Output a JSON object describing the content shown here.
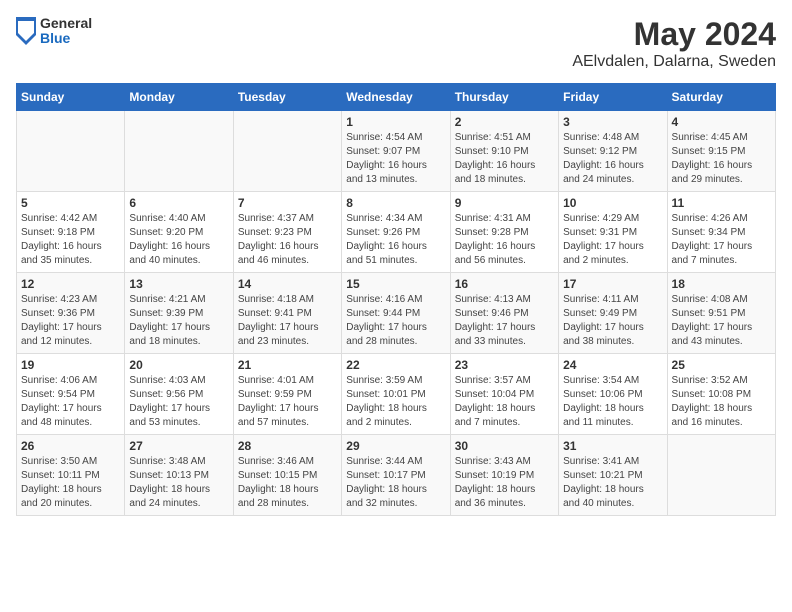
{
  "header": {
    "logo_general": "General",
    "logo_blue": "Blue",
    "title": "May 2024",
    "subtitle": "AElvdalen, Dalarna, Sweden"
  },
  "weekdays": [
    "Sunday",
    "Monday",
    "Tuesday",
    "Wednesday",
    "Thursday",
    "Friday",
    "Saturday"
  ],
  "rows": [
    [
      {
        "day": "",
        "content": ""
      },
      {
        "day": "",
        "content": ""
      },
      {
        "day": "",
        "content": ""
      },
      {
        "day": "1",
        "content": "Sunrise: 4:54 AM\nSunset: 9:07 PM\nDaylight: 16 hours\nand 13 minutes."
      },
      {
        "day": "2",
        "content": "Sunrise: 4:51 AM\nSunset: 9:10 PM\nDaylight: 16 hours\nand 18 minutes."
      },
      {
        "day": "3",
        "content": "Sunrise: 4:48 AM\nSunset: 9:12 PM\nDaylight: 16 hours\nand 24 minutes."
      },
      {
        "day": "4",
        "content": "Sunrise: 4:45 AM\nSunset: 9:15 PM\nDaylight: 16 hours\nand 29 minutes."
      }
    ],
    [
      {
        "day": "5",
        "content": "Sunrise: 4:42 AM\nSunset: 9:18 PM\nDaylight: 16 hours\nand 35 minutes."
      },
      {
        "day": "6",
        "content": "Sunrise: 4:40 AM\nSunset: 9:20 PM\nDaylight: 16 hours\nand 40 minutes."
      },
      {
        "day": "7",
        "content": "Sunrise: 4:37 AM\nSunset: 9:23 PM\nDaylight: 16 hours\nand 46 minutes."
      },
      {
        "day": "8",
        "content": "Sunrise: 4:34 AM\nSunset: 9:26 PM\nDaylight: 16 hours\nand 51 minutes."
      },
      {
        "day": "9",
        "content": "Sunrise: 4:31 AM\nSunset: 9:28 PM\nDaylight: 16 hours\nand 56 minutes."
      },
      {
        "day": "10",
        "content": "Sunrise: 4:29 AM\nSunset: 9:31 PM\nDaylight: 17 hours\nand 2 minutes."
      },
      {
        "day": "11",
        "content": "Sunrise: 4:26 AM\nSunset: 9:34 PM\nDaylight: 17 hours\nand 7 minutes."
      }
    ],
    [
      {
        "day": "12",
        "content": "Sunrise: 4:23 AM\nSunset: 9:36 PM\nDaylight: 17 hours\nand 12 minutes."
      },
      {
        "day": "13",
        "content": "Sunrise: 4:21 AM\nSunset: 9:39 PM\nDaylight: 17 hours\nand 18 minutes."
      },
      {
        "day": "14",
        "content": "Sunrise: 4:18 AM\nSunset: 9:41 PM\nDaylight: 17 hours\nand 23 minutes."
      },
      {
        "day": "15",
        "content": "Sunrise: 4:16 AM\nSunset: 9:44 PM\nDaylight: 17 hours\nand 28 minutes."
      },
      {
        "day": "16",
        "content": "Sunrise: 4:13 AM\nSunset: 9:46 PM\nDaylight: 17 hours\nand 33 minutes."
      },
      {
        "day": "17",
        "content": "Sunrise: 4:11 AM\nSunset: 9:49 PM\nDaylight: 17 hours\nand 38 minutes."
      },
      {
        "day": "18",
        "content": "Sunrise: 4:08 AM\nSunset: 9:51 PM\nDaylight: 17 hours\nand 43 minutes."
      }
    ],
    [
      {
        "day": "19",
        "content": "Sunrise: 4:06 AM\nSunset: 9:54 PM\nDaylight: 17 hours\nand 48 minutes."
      },
      {
        "day": "20",
        "content": "Sunrise: 4:03 AM\nSunset: 9:56 PM\nDaylight: 17 hours\nand 53 minutes."
      },
      {
        "day": "21",
        "content": "Sunrise: 4:01 AM\nSunset: 9:59 PM\nDaylight: 17 hours\nand 57 minutes."
      },
      {
        "day": "22",
        "content": "Sunrise: 3:59 AM\nSunset: 10:01 PM\nDaylight: 18 hours\nand 2 minutes."
      },
      {
        "day": "23",
        "content": "Sunrise: 3:57 AM\nSunset: 10:04 PM\nDaylight: 18 hours\nand 7 minutes."
      },
      {
        "day": "24",
        "content": "Sunrise: 3:54 AM\nSunset: 10:06 PM\nDaylight: 18 hours\nand 11 minutes."
      },
      {
        "day": "25",
        "content": "Sunrise: 3:52 AM\nSunset: 10:08 PM\nDaylight: 18 hours\nand 16 minutes."
      }
    ],
    [
      {
        "day": "26",
        "content": "Sunrise: 3:50 AM\nSunset: 10:11 PM\nDaylight: 18 hours\nand 20 minutes."
      },
      {
        "day": "27",
        "content": "Sunrise: 3:48 AM\nSunset: 10:13 PM\nDaylight: 18 hours\nand 24 minutes."
      },
      {
        "day": "28",
        "content": "Sunrise: 3:46 AM\nSunset: 10:15 PM\nDaylight: 18 hours\nand 28 minutes."
      },
      {
        "day": "29",
        "content": "Sunrise: 3:44 AM\nSunset: 10:17 PM\nDaylight: 18 hours\nand 32 minutes."
      },
      {
        "day": "30",
        "content": "Sunrise: 3:43 AM\nSunset: 10:19 PM\nDaylight: 18 hours\nand 36 minutes."
      },
      {
        "day": "31",
        "content": "Sunrise: 3:41 AM\nSunset: 10:21 PM\nDaylight: 18 hours\nand 40 minutes."
      },
      {
        "day": "",
        "content": ""
      }
    ]
  ]
}
